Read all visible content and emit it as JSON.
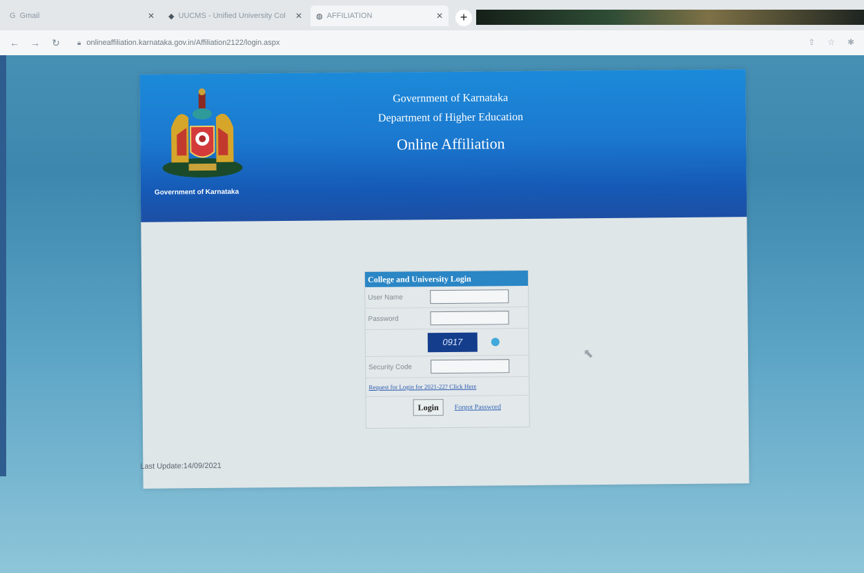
{
  "tabs": [
    {
      "label": "Gmail",
      "icon": "google-icon"
    },
    {
      "label": "UUCMS - Unified University Col",
      "icon": "uucms-icon"
    },
    {
      "label": "AFFILIATION",
      "icon": "globe-icon"
    }
  ],
  "address": {
    "url": "onlineaffiliation.karnataka.gov.in/Affiliation2122/login.aspx"
  },
  "banner": {
    "emblem_caption": "Government of Karnataka",
    "line1": "Government of Karnataka",
    "line2": "Department of Higher Education",
    "line3": "Online Affiliation"
  },
  "login": {
    "title": "College and University Login",
    "username_label": "User Name",
    "password_label": "Password",
    "captcha_text": "0917",
    "security_code_label": "Security Code",
    "request_link": "Request for Login for 2021-22? Click Here",
    "login_button": "Login",
    "forgot_password": "Forgot Password"
  },
  "footer": {
    "last_update": "Last Update:14/09/2021"
  },
  "colors": {
    "banner_blue": "#1b79cf",
    "login_header": "#2a86c5",
    "captcha_bg": "#143d8c"
  }
}
